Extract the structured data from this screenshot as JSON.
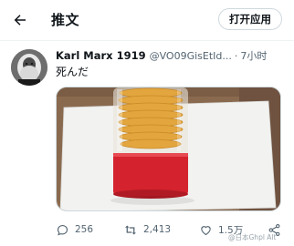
{
  "header": {
    "back_icon": "arrow-left-icon",
    "title": "推文",
    "open_app_label": "打开应用"
  },
  "tweet": {
    "display_name": "Karl Marx 1919",
    "handle": "@VO09GisEtId...",
    "separator": "·",
    "time": "7小时",
    "text": "死んだ",
    "media_alt": "photo of stacked snacks in a clear cylindrical container with a red base on white paper"
  },
  "actions": {
    "reply_count": "256",
    "retweet_count": "2,413",
    "like_count": "1.5万",
    "share_icon": "share-icon"
  },
  "watermark": "@日本Ghpl Alt",
  "colors": {
    "text_primary": "#0f1419",
    "text_secondary": "#536471",
    "border": "#cfd9de"
  }
}
